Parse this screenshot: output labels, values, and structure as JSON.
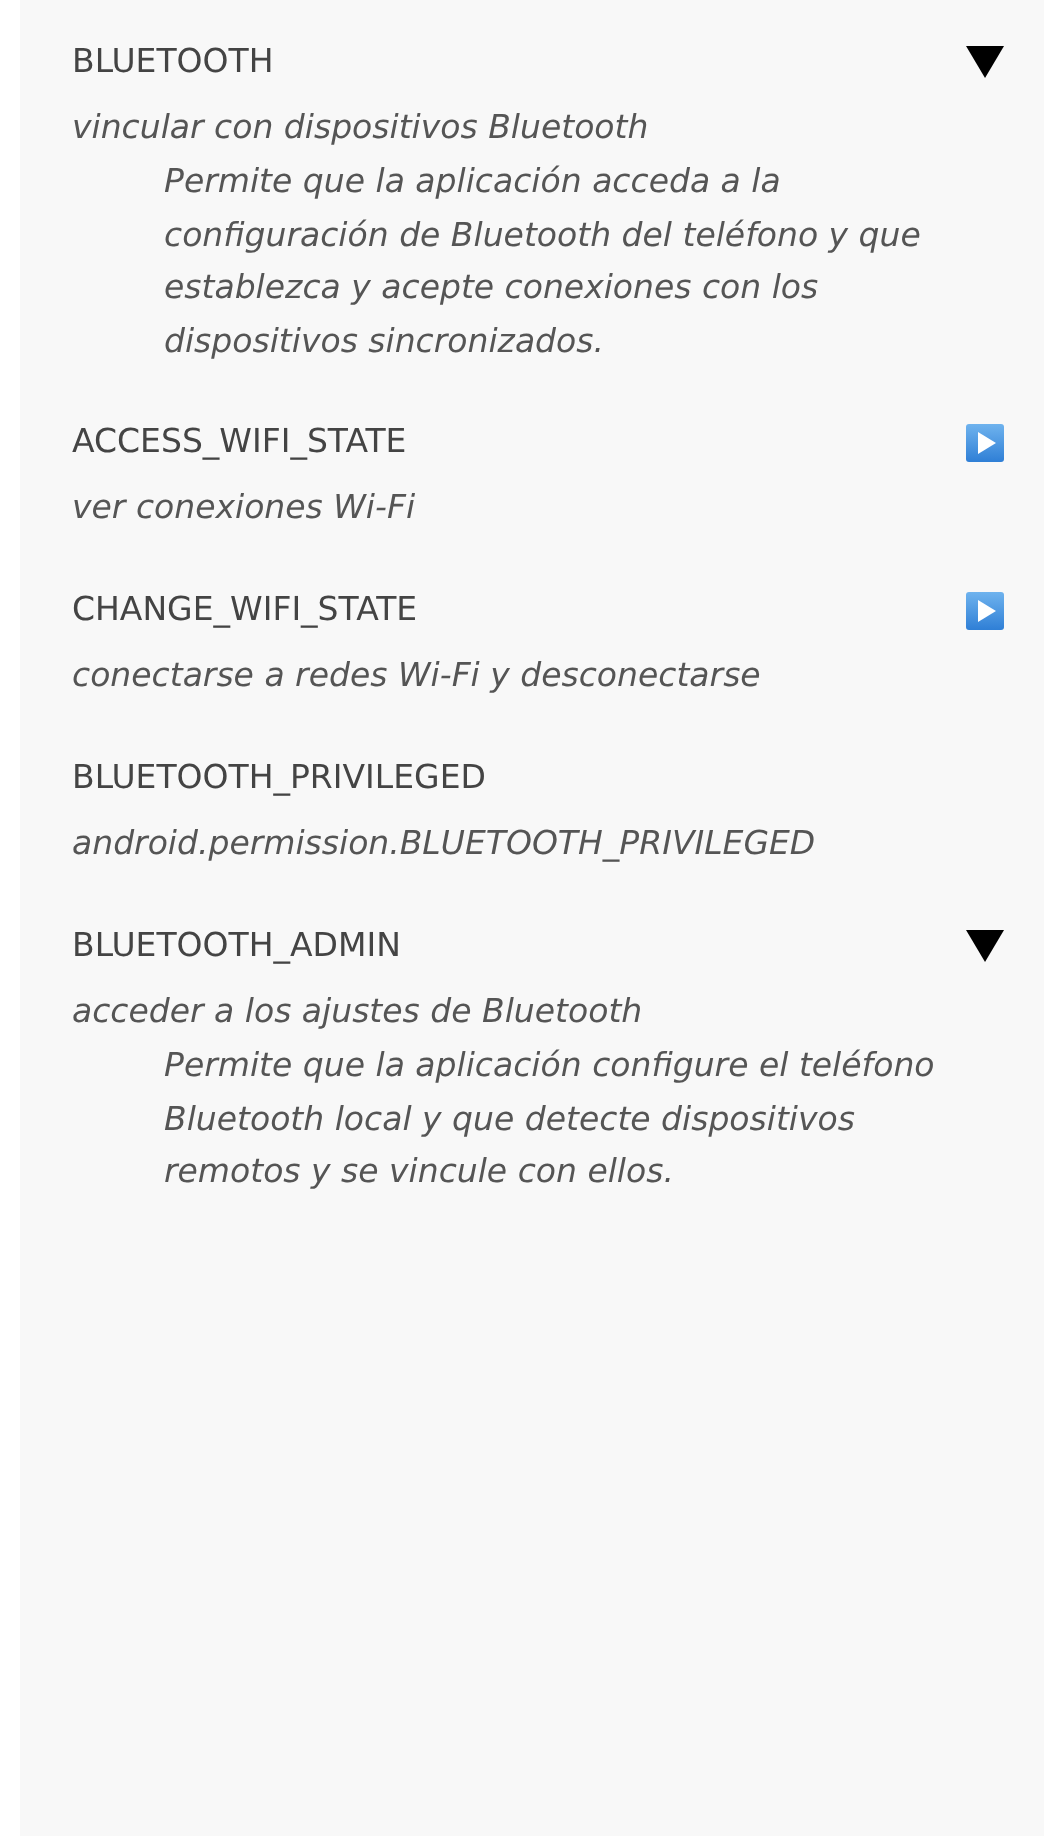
{
  "permissions": [
    {
      "name": "BLUETOOTH",
      "expanded": true,
      "summary": "vincular con dispositivos Bluetooth",
      "description": "Permite que la aplicación acceda a la configuración de Bluetooth del teléfono y que establezca y acepte conexiones con los dispositivos sincronizados."
    },
    {
      "name": "ACCESS_WIFI_STATE",
      "expanded": false,
      "summary": "ver conexiones Wi-Fi"
    },
    {
      "name": "CHANGE_WIFI_STATE",
      "expanded": false,
      "summary": "conectarse a redes Wi-Fi y desconectarse"
    },
    {
      "name": "BLUETOOTH_PRIVILEGED",
      "summary": "android.permission.BLUETOOTH_PRIVILEGED"
    },
    {
      "name": "BLUETOOTH_ADMIN",
      "expanded": true,
      "summary": "acceder a los ajustes de Bluetooth",
      "description": "Permite que la aplicación configure el teléfono Bluetooth local y que detecte dispositivos remotos y se vincule con ellos."
    }
  ]
}
